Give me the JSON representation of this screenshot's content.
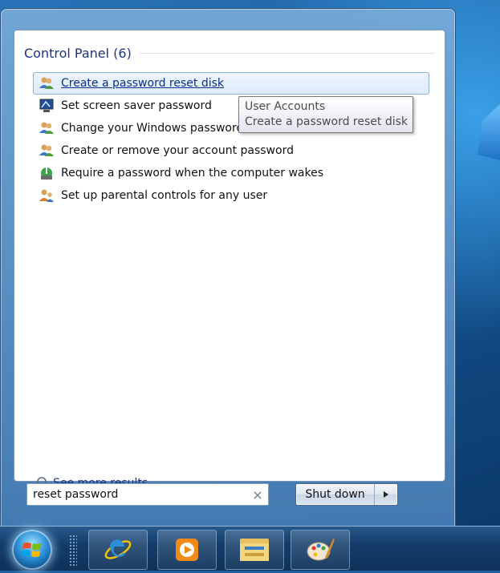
{
  "start_menu": {
    "group": {
      "title": "Control Panel (6)"
    },
    "results": [
      {
        "label": "Create a password reset disk",
        "icon": "user-accounts-icon",
        "hovered": true
      },
      {
        "label": "Set screen saver password",
        "icon": "screen-saver-icon",
        "hovered": false
      },
      {
        "label": "Change your Windows password",
        "icon": "user-accounts-icon",
        "hovered": false
      },
      {
        "label": "Create or remove your account password",
        "icon": "user-accounts-icon",
        "hovered": false
      },
      {
        "label": "Require a password when the computer wakes",
        "icon": "power-options-icon",
        "hovered": false
      },
      {
        "label": "Set up parental controls for any user",
        "icon": "parental-controls-icon",
        "hovered": false
      }
    ],
    "tooltip": {
      "line1": "User Accounts",
      "line2": "Create a password reset disk"
    },
    "see_more": "See more results",
    "search": {
      "value": "reset password",
      "clear_glyph": "×"
    },
    "shutdown": {
      "label": "Shut down",
      "arrow_glyph": "▸"
    }
  },
  "taskbar": {
    "start_button": "windows-orb-icon",
    "pinned": [
      "internet-explorer-icon",
      "media-player-icon",
      "windows-explorer-icon",
      "paint-icon"
    ]
  },
  "colors": {
    "accent": "#1e3287",
    "hover_bg": "#dcebfb",
    "hover_border": "#8fb3df"
  }
}
